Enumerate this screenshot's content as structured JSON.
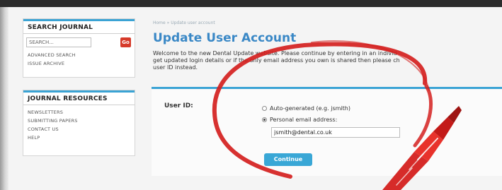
{
  "sidebar": {
    "search_box": {
      "title": "SEARCH JOURNAL",
      "search_placeholder": "SEARCH...",
      "go_label": "Go",
      "links": [
        "ADVANCED SEARCH",
        "ISSUE ARCHIVE"
      ]
    },
    "resources_box": {
      "title": "JOURNAL RESOURCES",
      "links": [
        "NEWSLETTERS",
        "SUBMITTING PAPERS",
        "CONTACT US",
        "HELP"
      ]
    }
  },
  "breadcrumb": "Home » Update user account",
  "page_title": "Update User Account",
  "intro_lines": [
    "Welcome to the new Dental Update website. Please continue by entering in an individ",
    "get updated login details or if the only email address you own is shared then please ch",
    "user ID instead."
  ],
  "form": {
    "user_id_label": "User ID:",
    "option_auto": "Auto-generated (e.g. jsmith)",
    "option_email": "Personal email address:",
    "email_value": "jsmith@dental.co.uk",
    "continue_label": "Continue"
  },
  "colors": {
    "accent": "#3aa3d4",
    "title": "#3a88c6",
    "go_button": "#d63a2a",
    "annotation": "#d4201e"
  },
  "icons": {
    "annotation": "red-circle-and-pen-mark"
  }
}
